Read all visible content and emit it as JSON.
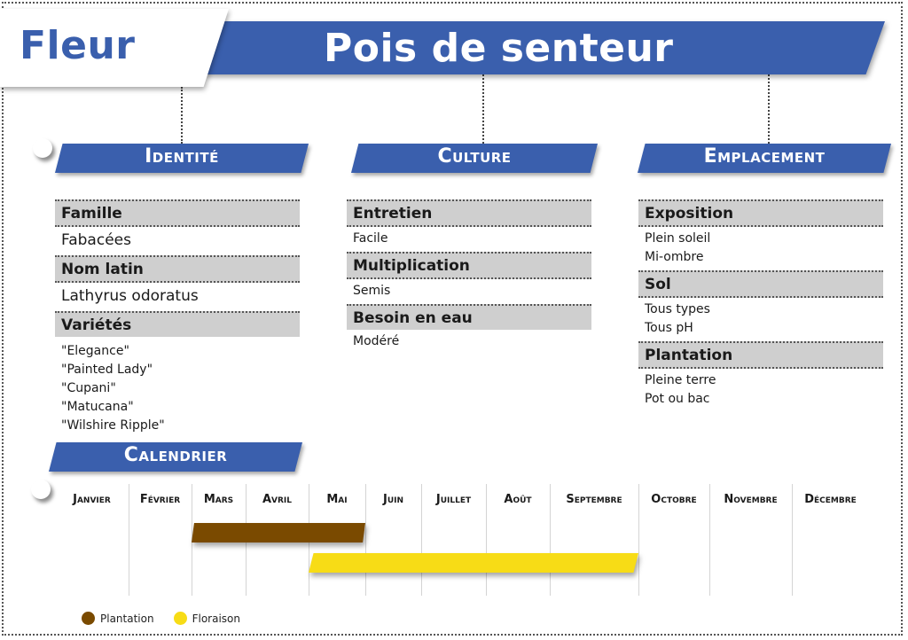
{
  "header": {
    "category": "Fleur",
    "title": "Pois de senteur"
  },
  "colors": {
    "brand_blue": "#3a5fad",
    "field_gray": "#cfcfcf",
    "plantation": "#7a4a00",
    "floraison": "#f7dc16"
  },
  "sections": {
    "identite": {
      "title": "Identité",
      "fields": [
        {
          "label": "Famille",
          "values": [
            "Fabacées"
          ]
        },
        {
          "label": "Nom latin",
          "values": [
            "Lathyrus odoratus"
          ]
        },
        {
          "label": "Variétés",
          "values": [
            "\"Elegance\"",
            "\"Painted Lady\"",
            "\"Cupani\"",
            "\"Matucana\"",
            "\"Wilshire Ripple\""
          ]
        }
      ]
    },
    "culture": {
      "title": "Culture",
      "fields": [
        {
          "label": "Entretien",
          "values": [
            "Facile"
          ]
        },
        {
          "label": "Multiplication",
          "values": [
            "Semis"
          ]
        },
        {
          "label": "Besoin en eau",
          "values": [
            "Modéré"
          ]
        }
      ]
    },
    "emplacement": {
      "title": "Emplacement",
      "fields": [
        {
          "label": "Exposition",
          "values": [
            "Plein soleil",
            "Mi-ombre"
          ]
        },
        {
          "label": "Sol",
          "values": [
            "Tous types",
            "Tous pH"
          ]
        },
        {
          "label": "Plantation",
          "values": [
            "Pleine terre",
            "Pot ou bac"
          ]
        }
      ]
    }
  },
  "calendar": {
    "title": "Calendrier",
    "months": [
      "Janvier",
      "Février",
      "Mars",
      "Avril",
      "Mai",
      "Juin",
      "Juillet",
      "Août",
      "Septembre",
      "Octobre",
      "Novembre",
      "Décembre"
    ],
    "periods": [
      {
        "name": "Plantation",
        "start_month": "Mars",
        "end_month": "Mai",
        "start_index": 2,
        "end_index": 4,
        "color": "#7a4a00"
      },
      {
        "name": "Floraison",
        "start_month": "Mai",
        "end_month": "Septembre",
        "start_index": 4,
        "end_index": 8,
        "color": "#f7dc16"
      }
    ],
    "legend": [
      {
        "label": "Plantation",
        "color": "#7a4a00"
      },
      {
        "label": "Floraison",
        "color": "#f7dc16"
      }
    ]
  }
}
